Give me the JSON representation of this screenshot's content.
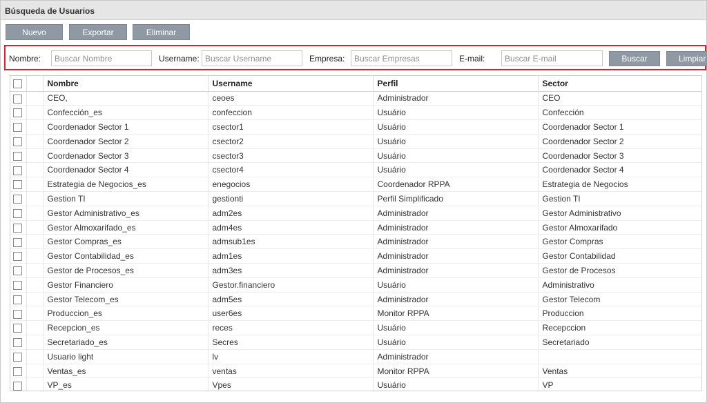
{
  "window": {
    "title": "Búsqueda de Usuarios"
  },
  "toolbar": {
    "nuevo_label": "Nuevo",
    "exportar_label": "Exportar",
    "eliminar_label": "Eliminar"
  },
  "filters": {
    "nombre_label": "Nombre:",
    "nombre_placeholder": "Buscar Nombre",
    "username_label": "Username:",
    "username_placeholder": "Buscar Username",
    "empresa_label": "Empresa:",
    "empresa_placeholder": "Buscar Empresas",
    "email_label": "E-mail:",
    "email_placeholder": "Buscar E-mail",
    "buscar_label": "Buscar",
    "limpiar_label": "Limpiar"
  },
  "table": {
    "columns": [
      "Nombre",
      "Username",
      "Perfil",
      "Sector"
    ],
    "rows": [
      [
        "CEO,",
        "ceoes",
        "Administrador",
        "CEO"
      ],
      [
        "Confección_es",
        "confeccion",
        "Usuário",
        "Confección"
      ],
      [
        "Coordenador Sector 1",
        "csector1",
        "Usuário",
        "Coordenador Sector 1"
      ],
      [
        "Coordenador Sector 2",
        "csector2",
        "Usuário",
        "Coordenador Sector 2"
      ],
      [
        "Coordenador Sector 3",
        "csector3",
        "Usuário",
        "Coordenador Sector 3"
      ],
      [
        "Coordenador Sector 4",
        "csector4",
        "Usuário",
        "Coordenador Sector 4"
      ],
      [
        "Estrategia de Negocios_es",
        "enegocios",
        "Coordenador RPPA",
        "Estrategia de Negocios"
      ],
      [
        "Gestion TI",
        "gestionti",
        "Perfil Simplificado",
        "Gestion TI"
      ],
      [
        "Gestor Administrativo_es",
        "adm2es",
        "Administrador",
        "Gestor Administrativo"
      ],
      [
        "Gestor Almoxarifado_es",
        "adm4es",
        "Administrador",
        "Gestor Almoxarifado"
      ],
      [
        "Gestor Compras_es",
        "admsub1es",
        "Administrador",
        "Gestor Compras"
      ],
      [
        "Gestor Contabilidad_es",
        "adm1es",
        "Administrador",
        "Gestor Contabilidad"
      ],
      [
        "Gestor de Procesos_es",
        "adm3es",
        "Administrador",
        "Gestor de Procesos"
      ],
      [
        "Gestor Financiero",
        "Gestor.financiero",
        "Usuário",
        "Administrativo"
      ],
      [
        "Gestor Telecom_es",
        "adm5es",
        "Administrador",
        "Gestor Telecom"
      ],
      [
        "Produccion_es",
        "user6es",
        "Monitor RPPA",
        "Produccion"
      ],
      [
        "Recepcion_es",
        "reces",
        "Usuário",
        "Recepccion"
      ],
      [
        "Secretariado_es",
        "Secres",
        "Usuário",
        "Secretariado"
      ],
      [
        "Usuario light",
        "lv",
        "Administrador",
        ""
      ],
      [
        "Ventas_es",
        "ventas",
        "Monitor RPPA",
        "Ventas"
      ],
      [
        "VP_es",
        "Vpes",
        "Usuário",
        "VP"
      ]
    ]
  }
}
